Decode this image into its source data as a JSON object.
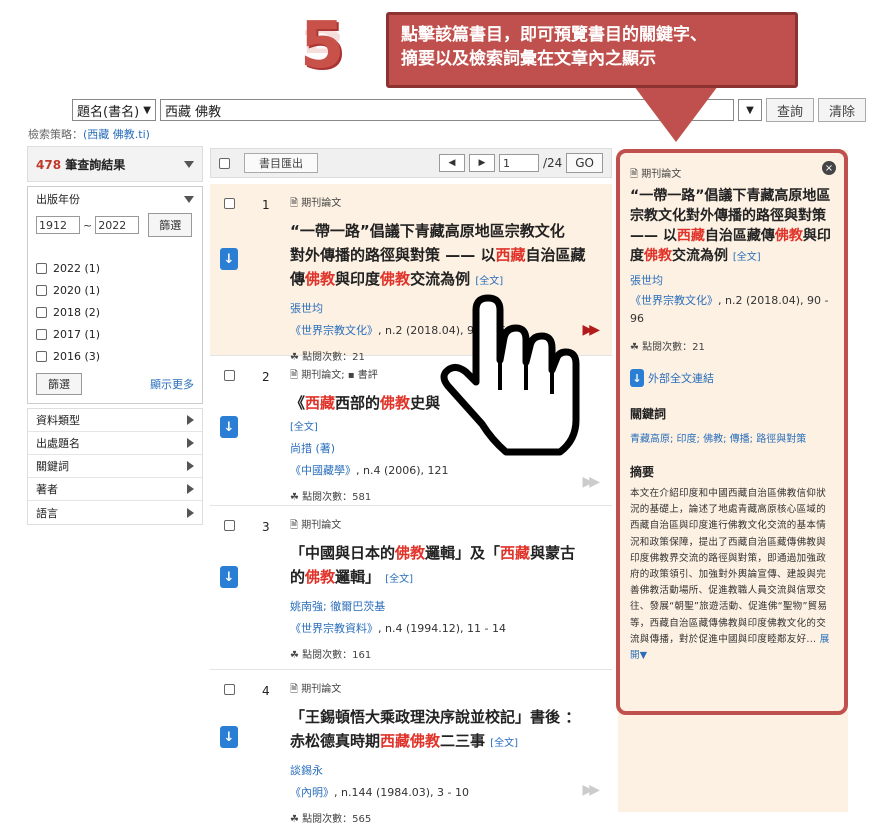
{
  "step": {
    "number": "5"
  },
  "callout": {
    "line1": "點擊該篇書目，即可預覽書目的關鍵字、",
    "line2": "摘要以及檢索詞彙在文章內之顯示"
  },
  "search": {
    "field": "題名(書名)",
    "query": "西藏 佛教",
    "query_btn": "查詢",
    "clear_btn": "清除"
  },
  "strategy": {
    "label": "檢索策略：",
    "value": "(西藏 佛教.ti)"
  },
  "results": {
    "count": "478",
    "label": "筆查詢結果"
  },
  "year_facet": {
    "label": "出版年份",
    "from": "1912",
    "to": "2022",
    "filter": "篩選",
    "items": [
      "2022 (1)",
      "2020 (1)",
      "2018 (2)",
      "2017 (1)",
      "2016 (3)"
    ],
    "more": "顯示更多"
  },
  "facets": [
    "資料類型",
    "出處題名",
    "關鍵詞",
    "著者",
    "語言"
  ],
  "toolbar": {
    "export": "書目匯出",
    "page": "1",
    "total": "/24",
    "go": "GO"
  },
  "items": [
    {
      "num": "1",
      "type": "期刊論文",
      "t1": "“一帶一路”倡議下青藏高原地區宗教文化",
      "t2": "對外傳播的路徑與對策 —— 以",
      "t3": "西藏",
      "t4": "自治區藏",
      "t5": "傳",
      "t6": "佛教",
      "t7": "與印度",
      "t8": "佛教",
      "t9": "交流為例",
      "full": "[全文]",
      "author": "張世均",
      "journal": "《世界宗教文化》",
      "src": ", n.2 (2018.04), 90 - 96",
      "views": "點閱次數：21"
    },
    {
      "num": "2",
      "type": "期刊論文; ",
      "type2": "書評",
      "t1": "《",
      "t2": "西藏",
      "t3": "西部的",
      "t4": "佛教",
      "t5": "史與",
      "t6": "介",
      "full": "[全文]",
      "author": "尚措 (著)",
      "journal": "《中國藏學》",
      "src": ", n.4 (2006), 121",
      "views": "點閱次數：581"
    },
    {
      "num": "3",
      "type": "期刊論文",
      "t1": "「中國與日本的",
      "t2": "佛教",
      "t3": "邏輯」及「",
      "t4": "西藏",
      "t5": "與蒙古",
      "t6": "的",
      "t7": "佛教",
      "t8": "邏輯」",
      "full": "[全文]",
      "author": "姚南強; 徹爾巴茨基",
      "journal": "《世界宗教資料》",
      "src": ", n.4 (1994.12), 11 - 14",
      "views": "點閱次數：161"
    },
    {
      "num": "4",
      "type": "期刊論文",
      "t1": "「王錫頓悟大乘政理決序說並校記」書後 ：",
      "t2": "赤松德真時期",
      "t3": "西藏佛教",
      "t4": "二三事",
      "full": "[全文]",
      "author": "談錫永",
      "journal": "《內明》",
      "src": ", n.144 (1984.03), 3 - 10",
      "views": "點閱次數：565"
    }
  ],
  "detail": {
    "close": "×",
    "type": "期刊論文",
    "t1": "“一帶一路”倡議下青藏高原地區宗教文化對外傳播的路徑與對策 —— 以",
    "t2": "西藏",
    "t3": "自治區藏傳",
    "t4": "佛教",
    "t5": "與印度",
    "t6": "佛教",
    "t7": "交流為例",
    "full": "[全文]",
    "author": "張世均",
    "journal": "《世界宗教文化》",
    "src": ", n.2 (2018.04), 90 - 96",
    "views": "點閱次數：21",
    "link": "外部全文連結",
    "kw_label": "關鍵詞",
    "keywords": "青藏高原; 印度; 佛教; 傳播; 路徑與對策",
    "abs_label": "摘要",
    "abstract": "本文在介紹印度和中國西藏自治區佛教信仰狀況的基礎上，論述了地處青藏高原核心區域的西藏自治區與印度進行佛教文化交流的基本情況和政策保障，提出了西藏自治區藏傳佛教與印度佛教界交流的路徑與對策，即通過加強政府的政策領引、加強對外輿論宣傳、建設與完善佛教活動場所、促進教職人員交流與信眾交往、發展“朝聖”旅遊活動、促進佛“聖物”貿易等，西藏自治區藏傳佛教與印度佛教文化的交流與傳播，對於促進中國與印度睦鄰友好...",
    "abs_more": "展開▼"
  }
}
